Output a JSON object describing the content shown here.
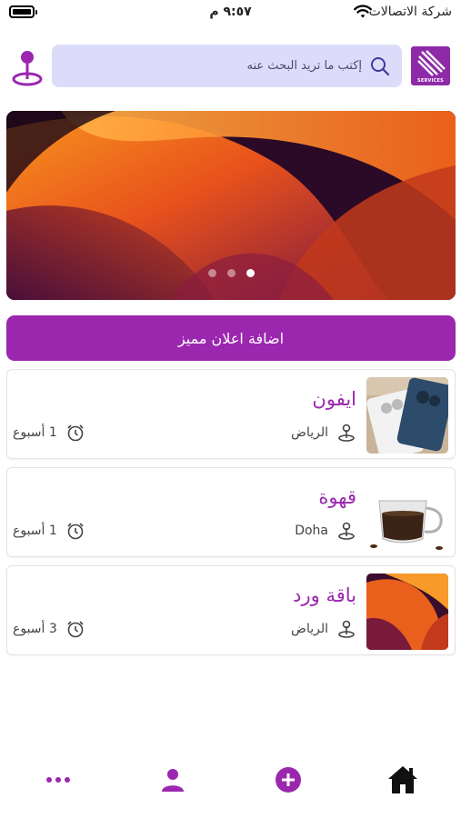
{
  "status_bar": {
    "carrier": "شركة الاتصالات",
    "time": "٩:٥٧ م"
  },
  "header": {
    "search_placeholder": "إكتب ما تريد البحث عنه",
    "logo_text": "SERVICES",
    "location_icon": "map-pin-icon",
    "search_icon": "search-icon"
  },
  "banner": {
    "slides": 3,
    "active_slide": 3
  },
  "feature_button": {
    "label": "اضافة اعلان مميز"
  },
  "listings": [
    {
      "title": "ايفون",
      "city": "الرياض",
      "age": "1 أسبوع",
      "thumb": "iphone-photo"
    },
    {
      "title": "قهوة",
      "city": "Doha",
      "age": "1 أسبوع",
      "thumb": "coffee-cup-photo"
    },
    {
      "title": "باقة ورد",
      "city": "الرياض",
      "age": "3 أسبوع",
      "thumb": "abstract-orange-photo"
    }
  ],
  "bottom_nav": {
    "items": [
      "home-icon",
      "add-icon",
      "profile-icon",
      "more-icon"
    ]
  },
  "colors": {
    "accent": "#9b27af",
    "search_bg": "#dcdcfa",
    "logo_bg": "#8e2aa8"
  }
}
